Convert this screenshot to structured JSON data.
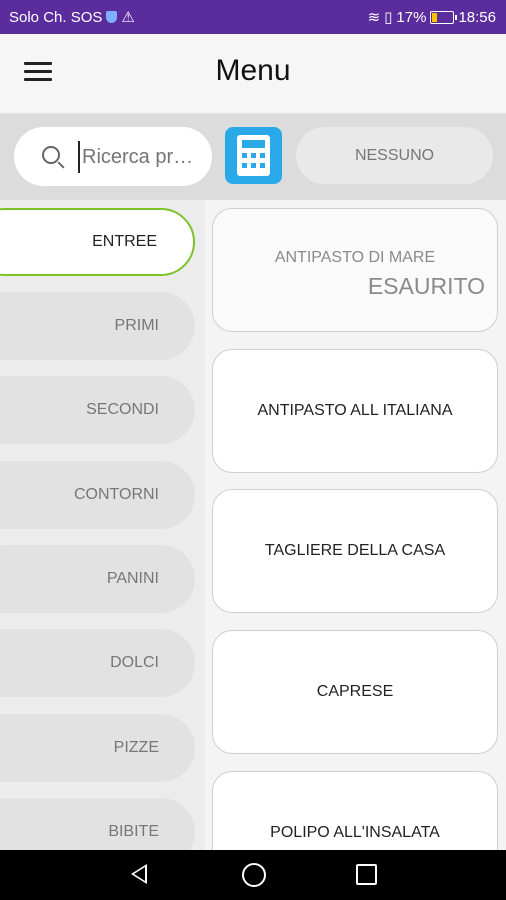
{
  "status_bar": {
    "carrier": "Solo Ch. SOS",
    "battery_percent": "17%",
    "time": "18:56",
    "icons": [
      "shield-icon",
      "warning-icon",
      "wifi-icon",
      "sim-icon",
      "battery-icon"
    ]
  },
  "app_bar": {
    "title": "Menu",
    "menu_icon": "hamburger-icon"
  },
  "search": {
    "placeholder": "Ricerca pr…",
    "value": ""
  },
  "calculator_button": {
    "icon": "calculator-icon",
    "color": "#29a9e8"
  },
  "none_button": {
    "label": "NESSUNO"
  },
  "categories": [
    {
      "label": "ENTREE",
      "active": true
    },
    {
      "label": "PRIMI",
      "active": false
    },
    {
      "label": "SECONDI",
      "active": false
    },
    {
      "label": "CONTORNI",
      "active": false
    },
    {
      "label": "PANINI",
      "active": false
    },
    {
      "label": "DOLCI",
      "active": false
    },
    {
      "label": "PIZZE",
      "active": false
    },
    {
      "label": "BIBITE",
      "active": false
    }
  ],
  "products": [
    {
      "name": "ANTIPASTO DI MARE",
      "status": "ESAURITO"
    },
    {
      "name": "ANTIPASTO ALL ITALIANA"
    },
    {
      "name": "TAGLIERE DELLA CASA"
    },
    {
      "name": "CAPRESE"
    },
    {
      "name": "POLIPO ALL'INSALATA"
    }
  ],
  "colors": {
    "status_bar": "#5b2d9c",
    "active_border": "#7cc42a",
    "accent": "#29a9e8"
  }
}
